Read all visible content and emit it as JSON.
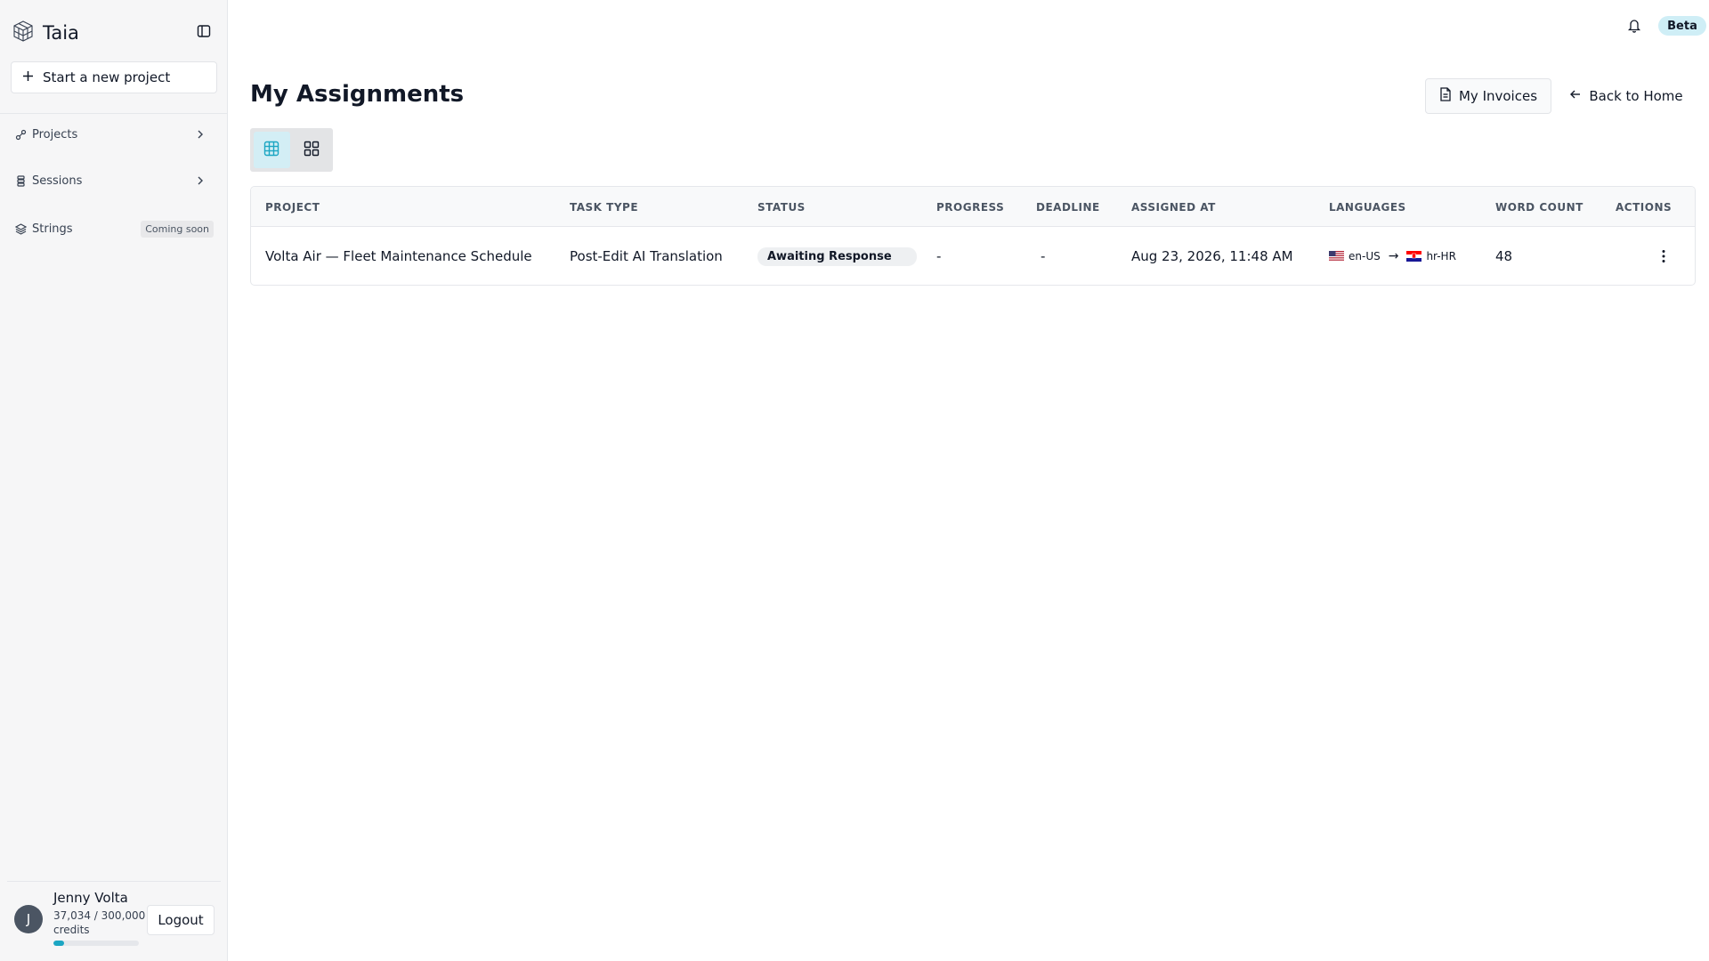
{
  "app": {
    "name": "Taia",
    "beta_label": "Beta"
  },
  "sidebar": {
    "new_project_label": "Start a new project",
    "items": [
      {
        "label": "Projects",
        "icon": "projects-icon"
      },
      {
        "label": "Sessions",
        "icon": "sessions-icon"
      },
      {
        "label": "Strings",
        "icon": "layers-icon",
        "badge": "Coming soon"
      }
    ],
    "user": {
      "initial": "J",
      "name": "Jenny Volta",
      "credits_text": "37,034 / 300,000 credits",
      "credits_used": 37034,
      "credits_total": 300000,
      "logout_label": "Logout"
    }
  },
  "header": {
    "title": "My Assignments",
    "invoices_label": "My Invoices",
    "back_label": "Back to Home"
  },
  "view_toggle": {
    "active": "table"
  },
  "table": {
    "columns": [
      "PROJECT",
      "TASK TYPE",
      "STATUS",
      "PROGRESS",
      "DEADLINE",
      "ASSIGNED AT",
      "LANGUAGES",
      "WORD COUNT",
      "ACTIONS"
    ],
    "rows": [
      {
        "project": "Volta Air — Fleet Maintenance Schedule",
        "task_type": "Post-Edit AI Translation",
        "status": "Awaiting Response",
        "progress": "-",
        "deadline": "-",
        "assigned_at": "Aug 23, 2026, 11:48 AM",
        "source_lang": "en-US",
        "target_lang": "hr-HR",
        "arrow": "→",
        "word_count": "48"
      }
    ]
  },
  "colors": {
    "accent": "#1ca6c3",
    "beta_bg": "#cfeef6",
    "toggle_active_bg": "#d3eef5"
  }
}
